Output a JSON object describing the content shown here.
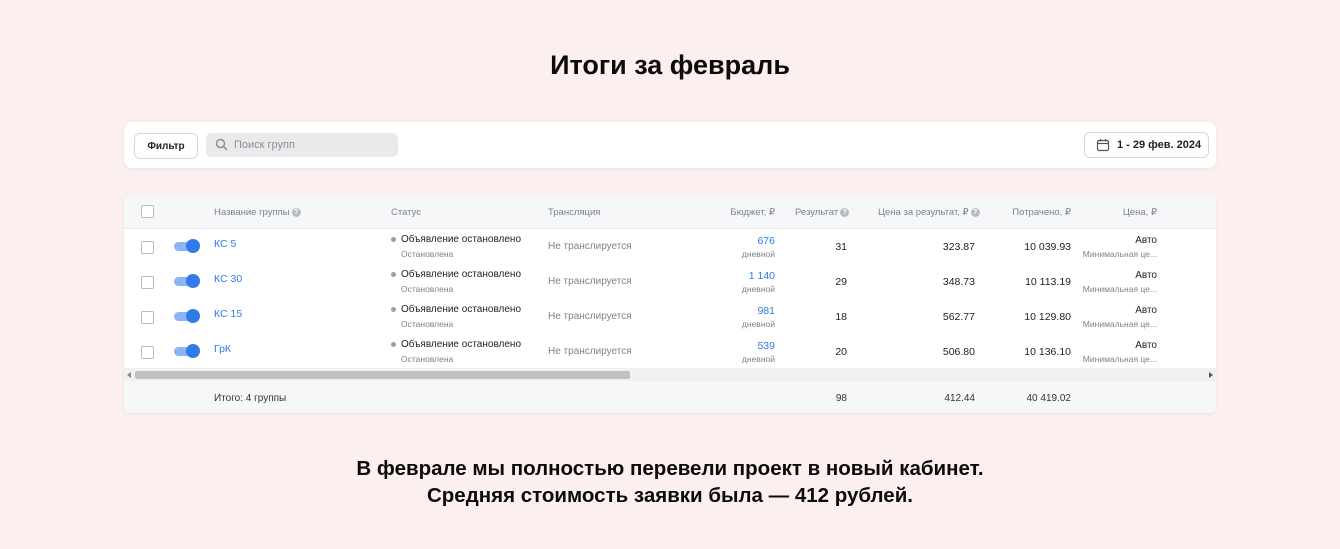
{
  "title": "Итоги за февраль",
  "toolbar": {
    "filter_label": "Фильтр",
    "search_placeholder": "Поиск групп",
    "date_range": "1 - 29 фев. 2024"
  },
  "table": {
    "headers": {
      "name": "Название группы",
      "status": "Статус",
      "broadcast": "Трансляция",
      "budget": "Бюджет, ₽",
      "result": "Результат",
      "cost_per_result": "Цена за результат, ₽",
      "spent": "Потрачено, ₽",
      "price": "Цена, ₽"
    },
    "rows": [
      {
        "name": "КС 5",
        "status": "Объявление остановлено",
        "status_sub": "Остановлена",
        "broadcast": "Не транслируется",
        "budget": "676",
        "budget_sub": "дневной",
        "result": "31",
        "cost_per_result": "323.87",
        "spent": "10 039.93",
        "price": "Авто",
        "price_sub": "Минимальная це..."
      },
      {
        "name": "КС 30",
        "status": "Объявление остановлено",
        "status_sub": "Остановлена",
        "broadcast": "Не транслируется",
        "budget": "1 140",
        "budget_sub": "дневной",
        "result": "29",
        "cost_per_result": "348.73",
        "spent": "10 113.19",
        "price": "Авто",
        "price_sub": "Минимальная це..."
      },
      {
        "name": "КС 15",
        "status": "Объявление остановлено",
        "status_sub": "Остановлена",
        "broadcast": "Не транслируется",
        "budget": "981",
        "budget_sub": "дневной",
        "result": "18",
        "cost_per_result": "562.77",
        "spent": "10 129.80",
        "price": "Авто",
        "price_sub": "Минимальная це..."
      },
      {
        "name": "ГрК",
        "status": "Объявление остановлено",
        "status_sub": "Остановлена",
        "broadcast": "Не транслируется",
        "budget": "539",
        "budget_sub": "дневной",
        "result": "20",
        "cost_per_result": "506.80",
        "spent": "10 136.10",
        "price": "Авто",
        "price_sub": "Минимальная це..."
      }
    ],
    "totals": {
      "label": "Итого: 4 группы",
      "result": "98",
      "cost_per_result": "412.44",
      "spent": "40 419.02"
    }
  },
  "summary": {
    "line1": "В феврале мы полностью перевели проект в новый кабинет.",
    "line2": "Средняя стоимость заявки была — 412 рублей."
  },
  "colors": {
    "background": "#fcefef",
    "accent": "#2f7ce8",
    "muted_text": "#7d828a"
  }
}
